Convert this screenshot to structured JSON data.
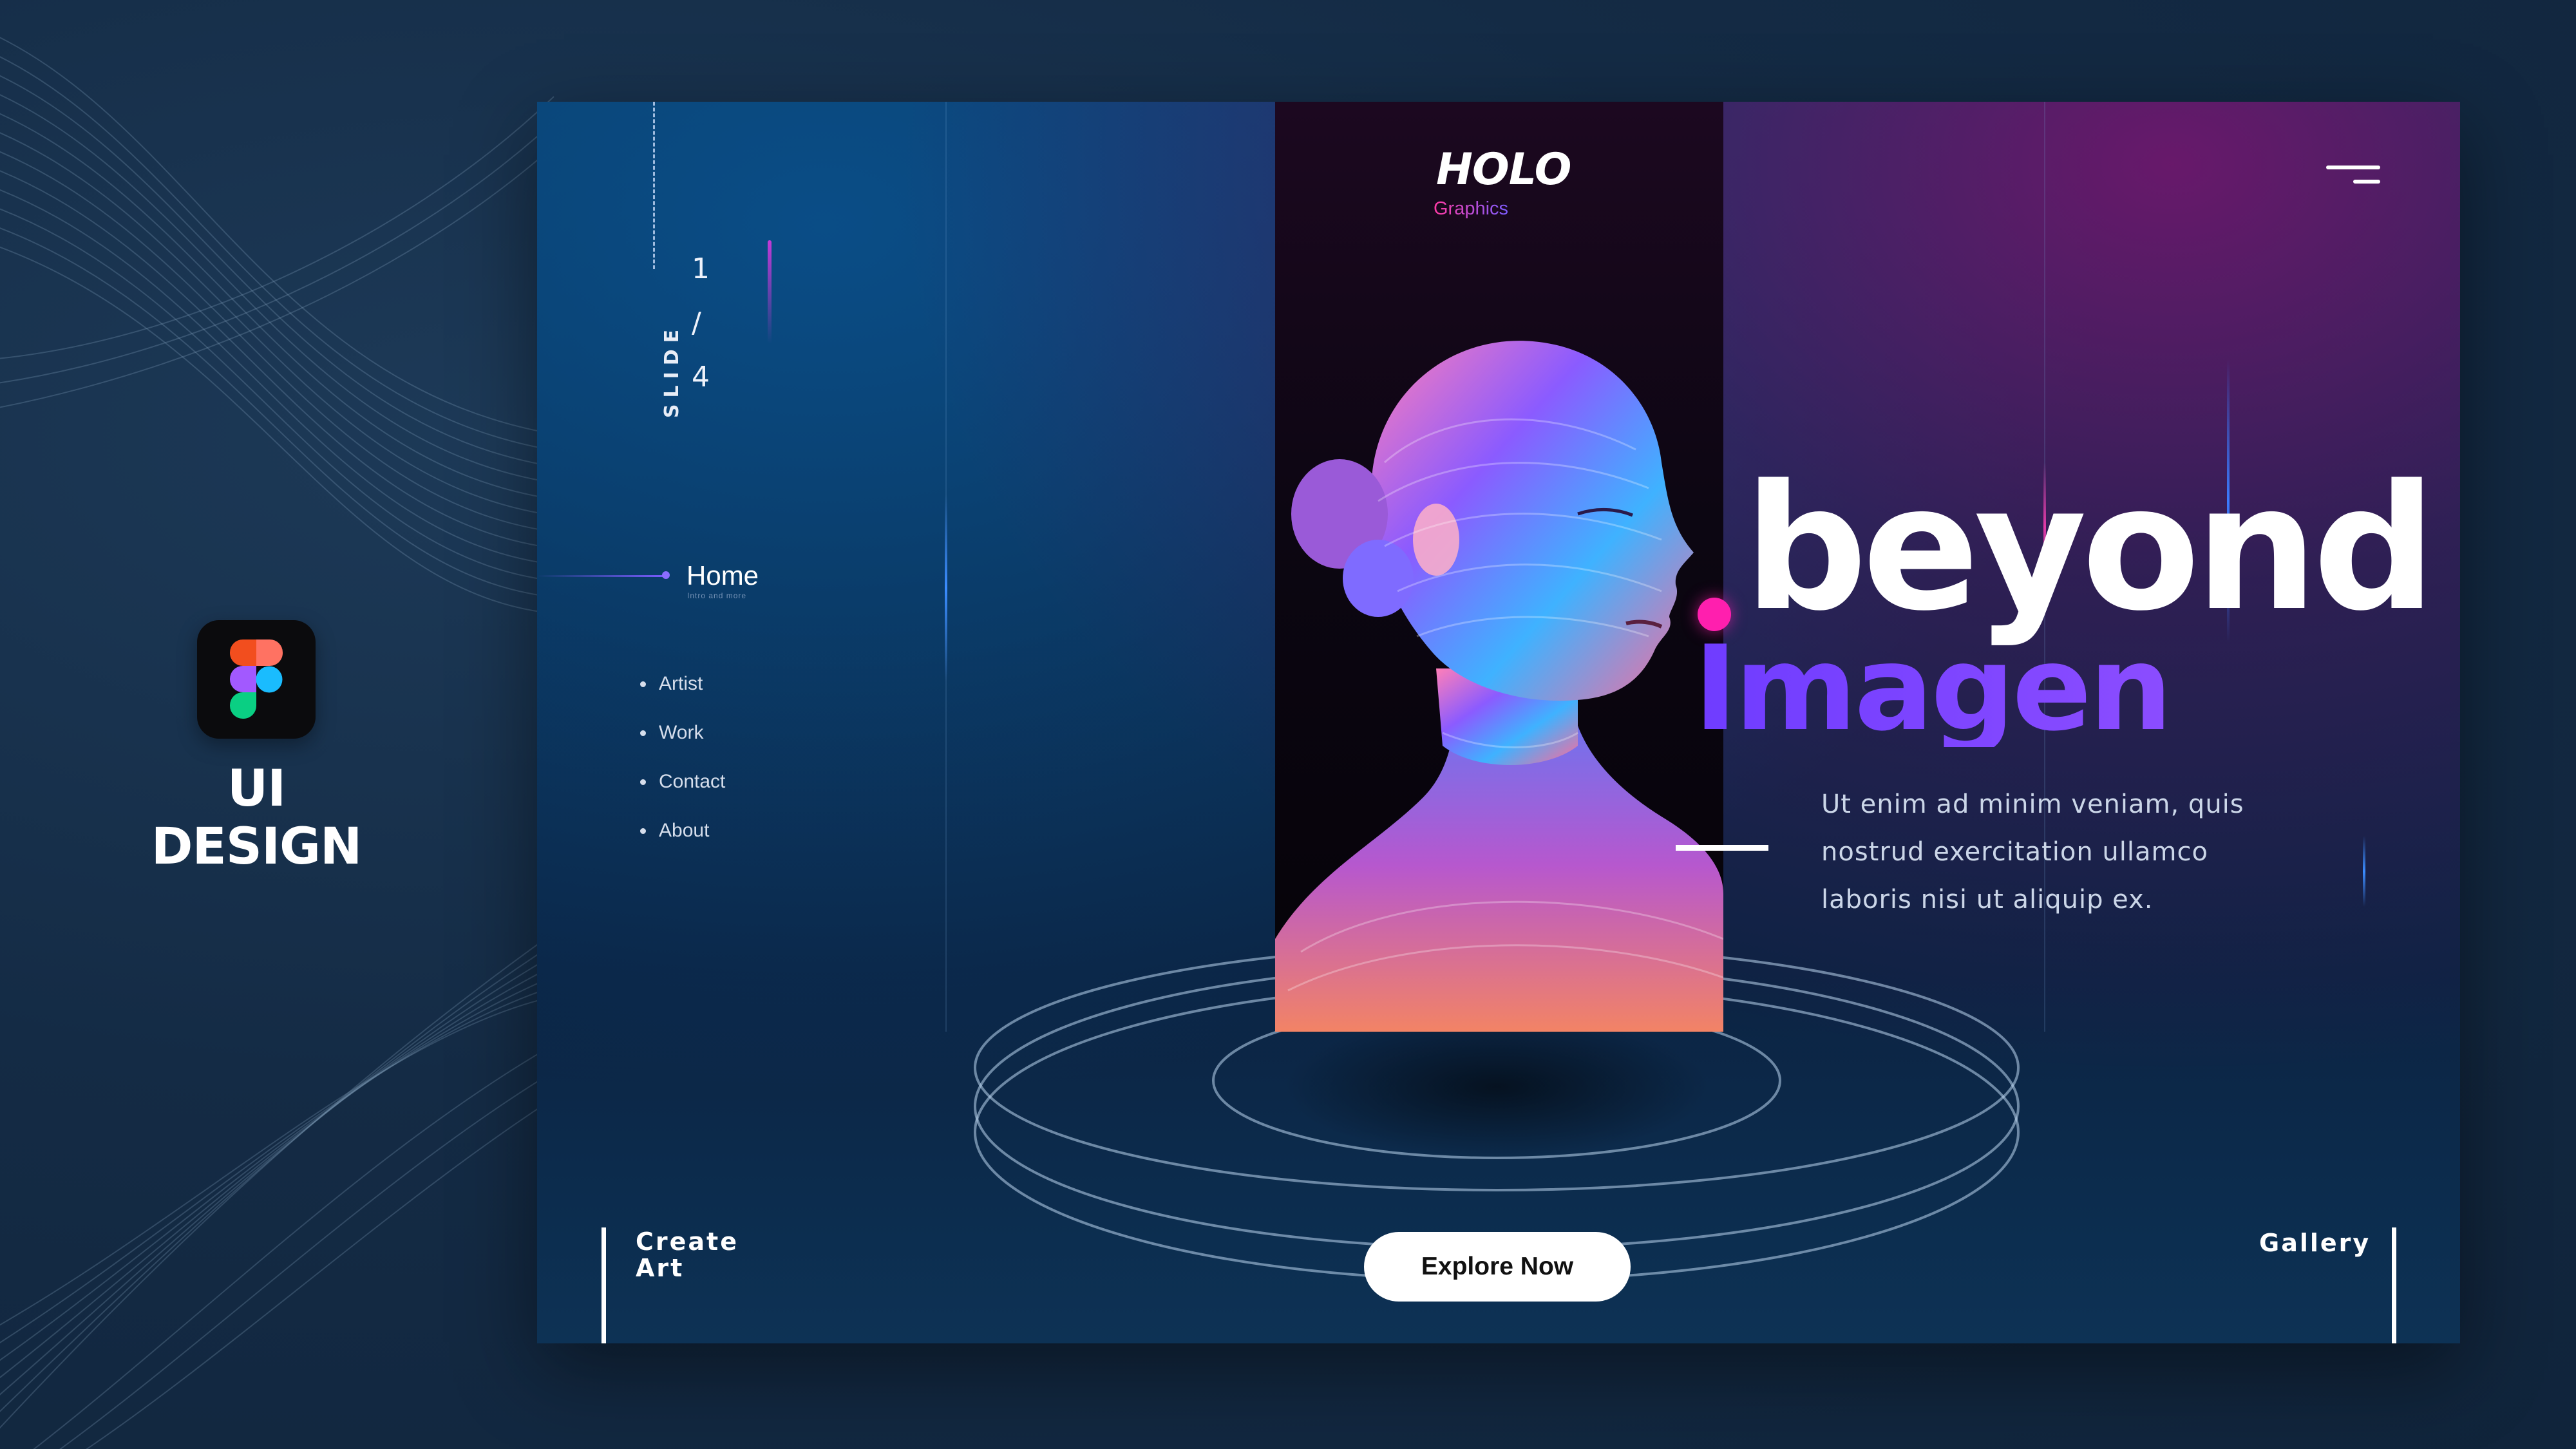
{
  "brand": {
    "label": "UI DESIGN",
    "icon": "figma-logo-icon",
    "figma_colors": [
      "#f24e1e",
      "#ff7262",
      "#a259ff",
      "#1abcfe",
      "#0acf83"
    ]
  },
  "site": {
    "logo_primary": "HOLO",
    "logo_secondary": "Graphics",
    "slide": {
      "word": "SLIDE",
      "current": "1",
      "separator": "/",
      "total": "4"
    },
    "nav": {
      "home_label": "Home",
      "home_sub": "Intro and more",
      "items": [
        "Artist",
        "Work",
        "Contact",
        "About"
      ]
    },
    "hero": {
      "heading_line1": "beyond",
      "heading_line2": "Imagen",
      "description_lines": [
        "Ut enim ad minim veniam, quis",
        "nostrud exercitation ullamco",
        "laboris nisi ut aliquip ex."
      ]
    },
    "cta_label": "Explore Now",
    "footer_left_lines": [
      "Create",
      "Art"
    ],
    "footer_right": "Gallery",
    "menu_icon": "hamburger-menu-icon"
  },
  "colors": {
    "accent_pink": "#ff1fae",
    "accent_purple": "#7b48ff",
    "background": "#10243b"
  }
}
